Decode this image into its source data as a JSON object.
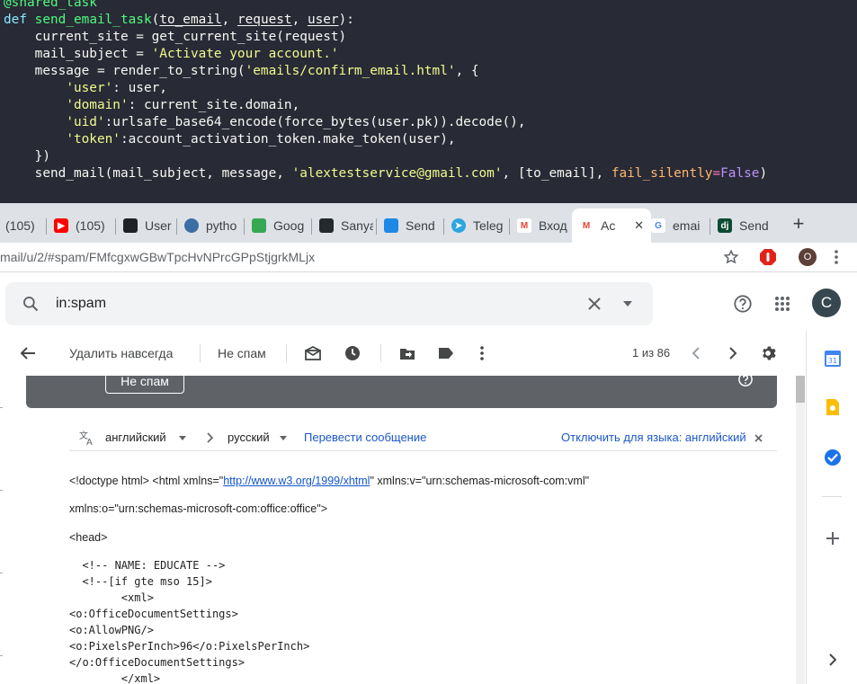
{
  "editor": {
    "lines": [
      [
        {
          "t": "@shared_task",
          "c": "c-dec"
        }
      ],
      [
        {
          "t": "def",
          "c": "c-kw"
        },
        {
          "t": " "
        },
        {
          "t": "send_email_task",
          "c": "c-fn"
        },
        {
          "t": "("
        },
        {
          "t": "to_email",
          "c": "c-arg"
        },
        {
          "t": ", "
        },
        {
          "t": "request",
          "c": "c-arg"
        },
        {
          "t": ", "
        },
        {
          "t": "user",
          "c": "c-arg"
        },
        {
          "t": "):"
        }
      ],
      [
        {
          "t": "    current_site = get_current_site(request)"
        }
      ],
      [
        {
          "t": "    mail_subject = "
        },
        {
          "t": "'Activate your account.'",
          "c": "c-str"
        }
      ],
      [
        {
          "t": "    message = render_to_string("
        },
        {
          "t": "'emails/confirm_email.html'",
          "c": "c-str"
        },
        {
          "t": ", {"
        }
      ],
      [
        {
          "t": "        "
        },
        {
          "t": "'user'",
          "c": "c-str"
        },
        {
          "t": ": user,"
        }
      ],
      [
        {
          "t": "        "
        },
        {
          "t": "'domain'",
          "c": "c-str"
        },
        {
          "t": ": current_site.domain,"
        }
      ],
      [
        {
          "t": "        "
        },
        {
          "t": "'uid'",
          "c": "c-str"
        },
        {
          "t": ":urlsafe_base64_encode(force_bytes(user.pk)).decode(),"
        }
      ],
      [
        {
          "t": "        "
        },
        {
          "t": "'token'",
          "c": "c-str"
        },
        {
          "t": ":account_activation_token.make_token(user),"
        }
      ],
      [
        {
          "t": "    })"
        }
      ],
      [
        {
          "t": "    send_mail(mail_subject, message, "
        },
        {
          "t": "'alextestservice@gmail.com'",
          "c": "c-str"
        },
        {
          "t": ", [to_email], "
        },
        {
          "t": "fail_silently",
          "c": "c-kwarg"
        },
        {
          "t": "=",
          "c": "c-op"
        },
        {
          "t": "False",
          "c": "c-const"
        },
        {
          "t": ")"
        }
      ]
    ]
  },
  "tabs": [
    {
      "label": "(105)",
      "icon": "inbox-icon",
      "color": "#5f6368"
    },
    {
      "label": "(105)",
      "icon": "youtube-icon",
      "color": "#ff0000"
    },
    {
      "label": "User",
      "icon": "mortarboard-icon",
      "color": "#202124"
    },
    {
      "label": "pytho",
      "icon": "python-icon",
      "color": "#3b6ea5"
    },
    {
      "label": "Goog",
      "icon": "google-arrows-icon",
      "color": "#34a853"
    },
    {
      "label": "Sanya",
      "icon": "github-icon",
      "color": "#24292e"
    },
    {
      "label": "Send",
      "icon": "dropbox-icon",
      "color": "#1e88e5"
    },
    {
      "label": "Teleg",
      "icon": "telegram-icon",
      "color": "#2ca5e0"
    },
    {
      "label": "Вход",
      "icon": "gmail-icon",
      "color": "#ea4335"
    },
    {
      "label": "Ac",
      "icon": "gmail-icon",
      "color": "#ea4335",
      "active": true
    },
    {
      "label": "emai",
      "icon": "google-icon",
      "color": "#4285f4"
    },
    {
      "label": "Send",
      "icon": "django-icon",
      "color": "#0c4b33"
    }
  ],
  "browser": {
    "new_tab": "+",
    "url": "mail/u/2/#spam/FMfcgxwGBwTpcHvNPrcGPpStjgrkMLjx",
    "profile_initial": "O"
  },
  "gmail": {
    "search_value": "in:spam",
    "avatar_initial": "C",
    "toolbar": {
      "delete_forever": "Удалить навсегда",
      "not_spam": "Не спам",
      "pagination": "1 из 86"
    },
    "banner_button": "Не спам",
    "translate": {
      "source_lang": "английский",
      "target_lang": "русский",
      "translate_link": "Перевести сообщение",
      "disable_link": "Отключить для языка: английский"
    },
    "body": {
      "line1_pre": "<!doctype html> <html xmlns=\"",
      "line1_link": "http://www.w3.org/1999/xhtml",
      "line1_post": "\" xmlns:v=\"urn:schemas-microsoft-com:vml\"",
      "line2": "xmlns:o=\"urn:schemas-microsoft-com:office:office\">",
      "line3": "<head>",
      "mono": [
        "  <!-- NAME: EDUCATE -->",
        "  <!--[if gte mso 15]>",
        "        <xml>",
        "<o:OfficeDocumentSettings>",
        "<o:AllowPNG/>",
        "<o:PixelsPerInch>96</o:PixelsPerInch>",
        "</o:OfficeDocumentSettings>",
        "        </xml>"
      ]
    }
  },
  "colors": {
    "editor_bg": "#282a36",
    "tabstrip_bg": "#dee1e6",
    "gmail_search_bg": "#f1f3f4",
    "link": "#1155cc"
  }
}
